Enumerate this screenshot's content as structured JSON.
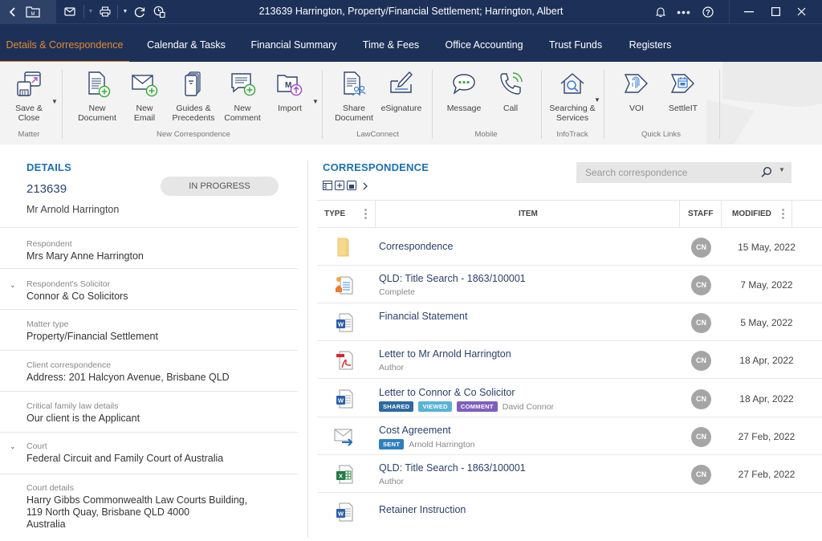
{
  "window": {
    "title": "213639 Harrington, Property/Financial Settlement; Harrington, Albert"
  },
  "nav": {
    "tabs": [
      {
        "label": "Details & Correspondence",
        "active": true
      },
      {
        "label": "Calendar & Tasks"
      },
      {
        "label": "Financial Summary"
      },
      {
        "label": "Time & Fees"
      },
      {
        "label": "Office Accounting"
      },
      {
        "label": "Trust Funds"
      },
      {
        "label": "Registers"
      }
    ]
  },
  "ribbon": {
    "buttons": {
      "save_close": "Save & Close",
      "new_document": "New Document",
      "new_email": "New Email",
      "guides_precedents": "Guides & Precedents",
      "new_comment": "New Comment",
      "import": "Import",
      "share_document": "Share Document",
      "esignature": "eSignature",
      "message": "Message",
      "call": "Call",
      "searching_services": "Searching & Services",
      "voi": "VOI",
      "settleit": "SettleIT"
    },
    "groups": {
      "matter": "Matter",
      "new_correspondence": "New Correspondence",
      "lawconnect": "LawConnect",
      "mobile": "Mobile",
      "infotrack": "InfoTrack",
      "quick_links": "Quick Links"
    }
  },
  "details": {
    "heading": "DETAILS",
    "matter_number": "213639",
    "client": "Mr Arnold Harrington",
    "status": "IN PROGRESS",
    "fields": [
      {
        "label": "Respondent",
        "value": "Mrs Mary Anne Harrington",
        "expandable": false
      },
      {
        "label": "Respondent's Solicitor",
        "value": "Connor & Co Solicitors",
        "expandable": true
      },
      {
        "label": "Matter type",
        "value": "Property/Financial Settlement",
        "expandable": false
      },
      {
        "label": "Client correspondence",
        "value": "Address: 201 Halcyon Avenue, Brisbane QLD",
        "expandable": false
      },
      {
        "label": "Critical family law details",
        "value": "Our client is the Applicant",
        "expandable": false
      },
      {
        "label": "Court",
        "value": "Federal Circuit and Family Court of Australia",
        "expandable": true
      },
      {
        "label": "Court details",
        "value_lines": [
          "Harry Gibbs Commonwealth Law Courts Building,",
          "119 North Quay, Brisbane QLD 4000",
          "Australia"
        ],
        "expandable": false
      }
    ]
  },
  "correspondence": {
    "heading": "CORRESPONDENCE",
    "search_placeholder": "Search correspondence",
    "columns": {
      "type": "TYPE",
      "item": "ITEM",
      "staff": "STAFF",
      "modified": "MODIFIED"
    },
    "badge_colors": {
      "SHARED": "#2d6aa0",
      "VIEWED": "#58b3d6",
      "COMMENT": "#7e5fbf",
      "SENT": "#2f7fc0"
    },
    "rows": [
      {
        "type": "folder",
        "title": "Correspondence",
        "sub": "",
        "badges": [],
        "staff": "CN",
        "modified": "15 May, 2022"
      },
      {
        "type": "title-search",
        "title": "QLD: Title Search - 1863/100001",
        "sub": "Complete",
        "badges": [],
        "staff": "CN",
        "modified": "7 May, 2022"
      },
      {
        "type": "word",
        "title": "Financial Statement",
        "sub": "",
        "badges": [],
        "staff": "CN",
        "modified": "5 May, 2022"
      },
      {
        "type": "pdf",
        "title": "Letter to Mr Arnold Harrington",
        "sub": "Author",
        "badges": [],
        "staff": "CN",
        "modified": "18 Apr, 2022"
      },
      {
        "type": "word",
        "title": "Letter to Connor & Co Solicitor",
        "sub": "David Connor",
        "badges": [
          "SHARED",
          "VIEWED",
          "COMMENT"
        ],
        "staff": "CN",
        "modified": "18 Apr, 2022"
      },
      {
        "type": "email-sent",
        "title": "Cost Agreement",
        "sub": "Arnold Harrington",
        "badges": [
          "SENT"
        ],
        "staff": "CN",
        "modified": "27 Feb, 2022"
      },
      {
        "type": "excel",
        "title": "QLD: Title Search - 1863/100001",
        "sub": "Author",
        "badges": [],
        "staff": "CN",
        "modified": "27 Feb, 2022"
      },
      {
        "type": "word",
        "title": "Retainer Instruction",
        "sub": "",
        "badges": [],
        "staff": "",
        "modified": ""
      }
    ]
  },
  "colors": {
    "header_bg": "#1d3158",
    "active_tab": "#e58a2e",
    "heading_blue": "#1c6fb8",
    "item_text": "#2b3f6b"
  }
}
